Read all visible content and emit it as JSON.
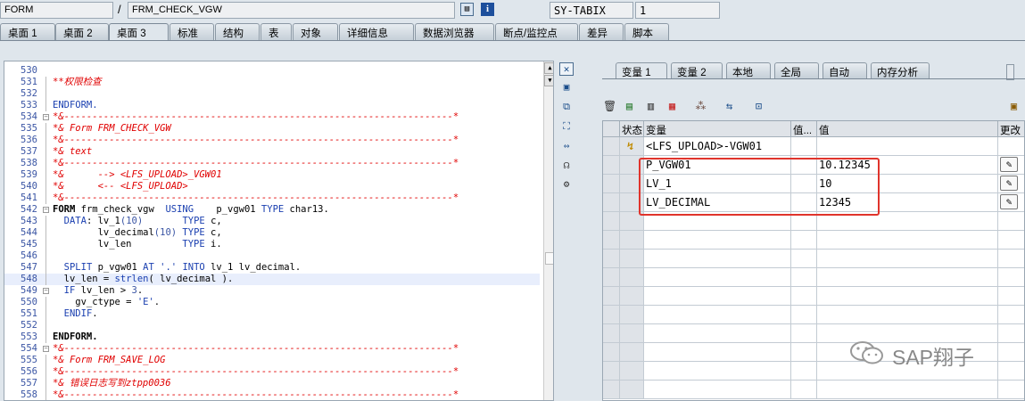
{
  "topbar": {
    "field1": "FORM",
    "separator": "/",
    "field2": "FRM_CHECK_VGW",
    "sy_label": "SY-TABIX",
    "sy_value": "1"
  },
  "tabs": [
    "桌面 1",
    "桌面 2",
    "桌面 3",
    "标准",
    "结构",
    "表",
    "对象",
    "详细信息",
    "数据浏览器",
    "断点/监控点",
    "差异",
    "脚本"
  ],
  "active_tab": "桌面 3",
  "code_lines": [
    {
      "n": "530",
      "t": "",
      "cls": ""
    },
    {
      "n": "531",
      "t": "**权限检查",
      "cls": "cm"
    },
    {
      "n": "532",
      "t": "",
      "cls": ""
    },
    {
      "n": "533",
      "t": "ENDFORM.",
      "cls": "kw"
    },
    {
      "n": "534",
      "t": "*&---------------------------------------------------------------------*",
      "cls": "cm",
      "fold": "⊟"
    },
    {
      "n": "535",
      "t": "*& Form FRM_CHECK_VGW",
      "cls": "cm"
    },
    {
      "n": "536",
      "t": "*&---------------------------------------------------------------------*",
      "cls": "cm"
    },
    {
      "n": "537",
      "t": "*& text",
      "cls": "cm"
    },
    {
      "n": "538",
      "t": "*&---------------------------------------------------------------------*",
      "cls": "cm"
    },
    {
      "n": "539",
      "t": "*&      --> <LFS_UPLOAD>_VGW01",
      "cls": "cm"
    },
    {
      "n": "540",
      "t": "*&      <-- <LFS_UPLOAD>",
      "cls": "cm"
    },
    {
      "n": "541",
      "t": "*&---------------------------------------------------------------------*",
      "cls": "cm"
    },
    {
      "n": "542",
      "t": "FORM frm_check_vgw  USING    p_vgw01 TYPE char13.",
      "cls": "form",
      "fold": "⊟"
    },
    {
      "n": "543",
      "t": "  DATA: lv_1(10)       TYPE c,",
      "cls": "data"
    },
    {
      "n": "544",
      "t": "        lv_decimal(10) TYPE c,",
      "cls": "data"
    },
    {
      "n": "545",
      "t": "        lv_len         TYPE i.",
      "cls": "data"
    },
    {
      "n": "546",
      "t": "",
      "cls": ""
    },
    {
      "n": "547",
      "t": "  SPLIT p_vgw01 AT '.' INTO lv_1 lv_decimal.",
      "cls": ""
    },
    {
      "n": "548",
      "t": "  lv_len = strlen( lv_decimal ).",
      "cls": "",
      "current": true
    },
    {
      "n": "549",
      "t": "  IF lv_len > 3.",
      "cls": "",
      "fold": "⊟"
    },
    {
      "n": "550",
      "t": "    gv_ctype = 'E'.",
      "cls": ""
    },
    {
      "n": "551",
      "t": "  ENDIF.",
      "cls": ""
    },
    {
      "n": "552",
      "t": "",
      "cls": ""
    },
    {
      "n": "553",
      "t": "ENDFORM.",
      "cls": "kwb"
    },
    {
      "n": "554",
      "t": "*&---------------------------------------------------------------------*",
      "cls": "cm",
      "fold": "⊟"
    },
    {
      "n": "555",
      "t": "*& Form FRM_SAVE_LOG",
      "cls": "cm"
    },
    {
      "n": "556",
      "t": "*&---------------------------------------------------------------------*",
      "cls": "cm"
    },
    {
      "n": "557",
      "t": "*& 错误日志写到ztpp0036",
      "cls": "cm"
    },
    {
      "n": "558",
      "t": "*&---------------------------------------------------------------------*",
      "cls": "cm"
    }
  ],
  "var_tabs": [
    "变量 1",
    "变量 2",
    "本地",
    "全局",
    "自动",
    "内存分析"
  ],
  "grid": {
    "headers": {
      "status": "状态",
      "variable": "变量",
      "val_short": "值...",
      "value": "值",
      "change": "更改"
    },
    "rows": [
      {
        "var": "<LFS_UPLOAD>-VGW01",
        "value": "",
        "has_pencil": false,
        "status_icon": true
      },
      {
        "var": "P_VGW01",
        "value": "10.12345",
        "has_pencil": true
      },
      {
        "var": "LV_1",
        "value": "10",
        "has_pencil": true
      },
      {
        "var": "LV_DECIMAL",
        "value": "12345",
        "has_pencil": true
      }
    ]
  },
  "watermark": "SAP翔子",
  "colors": {
    "highlight_box": "#e0342c",
    "comment": "#e00000",
    "keyword": "#1a3fb0"
  }
}
